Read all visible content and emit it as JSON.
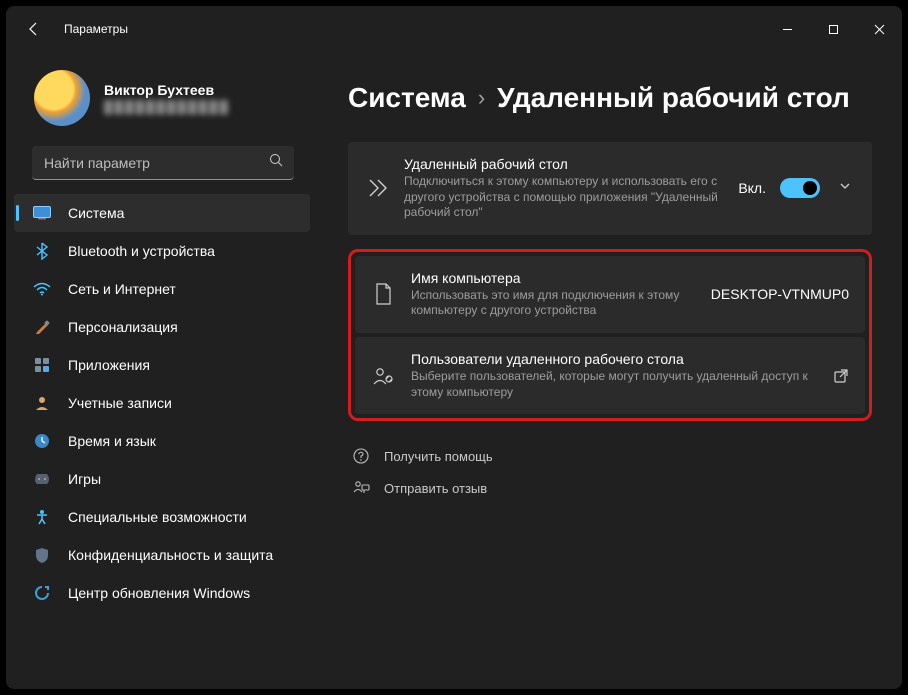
{
  "window_title": "Параметры",
  "profile": {
    "name": "Виктор Бухтеев",
    "email_masked": "████████████"
  },
  "search": {
    "placeholder": "Найти параметр"
  },
  "nav": [
    {
      "label": "Система"
    },
    {
      "label": "Bluetooth и устройства"
    },
    {
      "label": "Сеть и Интернет"
    },
    {
      "label": "Персонализация"
    },
    {
      "label": "Приложения"
    },
    {
      "label": "Учетные записи"
    },
    {
      "label": "Время и язык"
    },
    {
      "label": "Игры"
    },
    {
      "label": "Специальные возможности"
    },
    {
      "label": "Конфиденциальность и защита"
    },
    {
      "label": "Центр обновления Windows"
    }
  ],
  "breadcrumb": {
    "parent": "Система",
    "current": "Удаленный рабочий стол"
  },
  "rdp_card": {
    "title": "Удаленный рабочий стол",
    "desc": "Подключиться к этому компьютеру и использовать его с другого устройства с помощью приложения \"Удаленный рабочий стол\"",
    "toggle_label": "Вкл."
  },
  "pc_card": {
    "title": "Имя компьютера",
    "desc": "Использовать это имя для подключения к этому компьютеру с другого устройства",
    "value": "DESKTOP-VTNMUP0"
  },
  "users_card": {
    "title": "Пользователи удаленного рабочего стола",
    "desc": "Выберите пользователей, которые могут получить удаленный доступ к этому компьютеру"
  },
  "footer": {
    "help": "Получить помощь",
    "feedback": "Отправить отзыв"
  }
}
